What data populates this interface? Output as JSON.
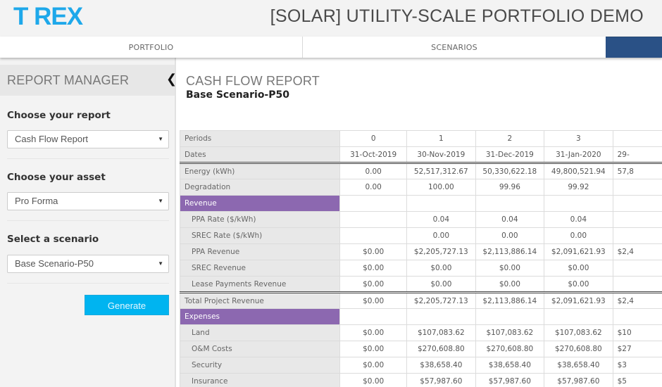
{
  "header": {
    "logo": "T REX",
    "title": "[SOLAR] UTILITY-SCALE PORTFOLIO DEMO",
    "brand_color": "#1ea8ea"
  },
  "nav": {
    "tabs": [
      {
        "label": "PORTFOLIO",
        "active": false
      },
      {
        "label": "SCENARIOS",
        "active": false
      },
      {
        "label": "",
        "active": true
      }
    ],
    "active_color": "#2a5186"
  },
  "sidebar": {
    "title": "REPORT MANAGER",
    "collapse_icon": "chevron-left-icon",
    "fields": [
      {
        "label": "Choose your report",
        "value": "Cash Flow Report"
      },
      {
        "label": "Choose your asset",
        "value": "Pro Forma"
      },
      {
        "label": "Select a scenario",
        "value": "Base Scenario-P50"
      }
    ],
    "generate_label": "Generate",
    "generate_color": "#00b4f0"
  },
  "report": {
    "title": "CASH FLOW REPORT",
    "subtitle": "Base Scenario-P50",
    "section_color": "#8c68b0",
    "rows": [
      {
        "label": "Periods",
        "type": "header",
        "values": [
          "0",
          "1",
          "2",
          "3",
          ""
        ]
      },
      {
        "label": "Dates",
        "type": "header",
        "values": [
          "31-Oct-2019",
          "30-Nov-2019",
          "31-Dec-2019",
          "31-Jan-2020",
          "29-"
        ]
      },
      {
        "label": "Energy (kWh)",
        "type": "row",
        "values": [
          "0.00",
          "52,517,312.67",
          "50,330,622.18",
          "49,800,521.94",
          "57,8"
        ]
      },
      {
        "label": "Degradation",
        "type": "row",
        "values": [
          "0.00",
          "100.00",
          "99.96",
          "99.92",
          ""
        ]
      },
      {
        "label": "Revenue",
        "type": "section",
        "values": [
          "",
          "",
          "",
          "",
          ""
        ]
      },
      {
        "label": "PPA Rate ($/kWh)",
        "type": "sub",
        "values": [
          "",
          "0.04",
          "0.04",
          "0.04",
          ""
        ]
      },
      {
        "label": "SREC Rate ($/kWh)",
        "type": "sub",
        "values": [
          "",
          "0.00",
          "0.00",
          "0.00",
          ""
        ]
      },
      {
        "label": "PPA Revenue",
        "type": "sub",
        "values": [
          "$0.00",
          "$2,205,727.13",
          "$2,113,886.14",
          "$2,091,621.93",
          "$2,4"
        ]
      },
      {
        "label": "SREC Revenue",
        "type": "sub",
        "values": [
          "$0.00",
          "$0.00",
          "$0.00",
          "$0.00",
          ""
        ]
      },
      {
        "label": "Lease Payments Revenue",
        "type": "sub",
        "values": [
          "$0.00",
          "$0.00",
          "$0.00",
          "$0.00",
          ""
        ]
      },
      {
        "label": "Total Project Revenue",
        "type": "row",
        "values": [
          "$0.00",
          "$2,205,727.13",
          "$2,113,886.14",
          "$2,091,621.93",
          "$2,4"
        ]
      },
      {
        "label": "Expenses",
        "type": "section",
        "values": [
          "",
          "",
          "",
          "",
          ""
        ]
      },
      {
        "label": "Land",
        "type": "sub",
        "values": [
          "$0.00",
          "$107,083.62",
          "$107,083.62",
          "$107,083.62",
          "$10"
        ]
      },
      {
        "label": "O&M Costs",
        "type": "sub",
        "values": [
          "$0.00",
          "$270,608.80",
          "$270,608.80",
          "$270,608.80",
          "$27"
        ]
      },
      {
        "label": "Security",
        "type": "sub",
        "values": [
          "$0.00",
          "$38,658.40",
          "$38,658.40",
          "$38,658.40",
          "$3"
        ]
      },
      {
        "label": "Insurance",
        "type": "sub",
        "values": [
          "$0.00",
          "$57,987.60",
          "$57,987.60",
          "$57,987.60",
          "$5"
        ]
      }
    ]
  }
}
